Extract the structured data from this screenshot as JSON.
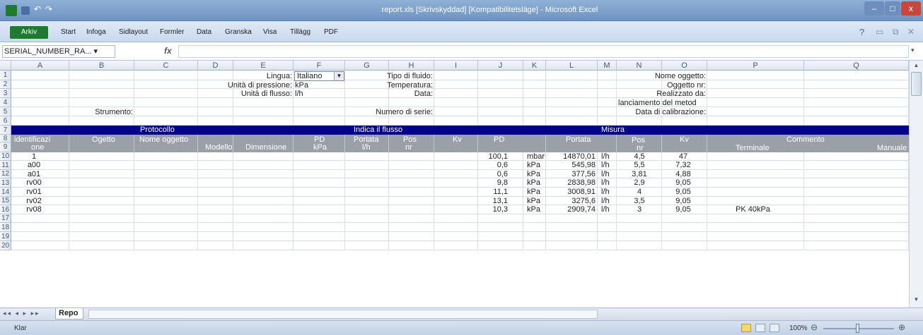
{
  "window": {
    "title": "report.xls [Skrivskyddad] [Kompatibilitetsläge] - Microsoft Excel",
    "minimize": "–",
    "maximize": "□",
    "close": "x"
  },
  "ribbon": {
    "file_tab": "Arkiv",
    "tabs": [
      "Start",
      "Infoga",
      "Sidlayout",
      "Formler",
      "Data",
      "Granska",
      "Visa",
      "Tillägg",
      "PDF"
    ]
  },
  "formula_bar": {
    "name_box": "SERIAL_NUMBER_RA... ▾",
    "fx": "fx",
    "value": ""
  },
  "columns": [
    "A",
    "B",
    "C",
    "D",
    "E",
    "F",
    "G",
    "H",
    "I",
    "J",
    "K",
    "L",
    "M",
    "N",
    "O",
    "P",
    "Q"
  ],
  "rows": [
    "1",
    "2",
    "3",
    "4",
    "5",
    "6",
    "7",
    "8",
    "9",
    "10",
    "11",
    "12",
    "13",
    "14",
    "15",
    "16",
    "17",
    "18",
    "19",
    "20"
  ],
  "header_area": {
    "lingua_label": "Lingua:",
    "lingua_value": "Italiano",
    "pressione_label": "Unità di pressione:",
    "pressione_value": "kPa",
    "flusso_label": "Unità di flusso:",
    "flusso_value": "l/h",
    "strumento_label": "Strumento:",
    "fluido_label": "Tipo di fluido:",
    "temperatura_label": "Temperatura:",
    "data_label": "Data:",
    "serie_label": "Numero di serie:",
    "nome_oggetto_label": "Nome oggetto:",
    "oggetto_nr_label": "Oggetto nr:",
    "realizzato_label": "Realizzato da:",
    "metodo_label": "lanciamento del metod",
    "calibrazione_label": "Data di calibrazione:"
  },
  "sections": {
    "protocollo": "Protocollo",
    "indica": "Indica il flusso",
    "misura": "Misura"
  },
  "table_headers": {
    "identificazione_1": "identificazi",
    "identificazione_2": "one",
    "oggetto": "Ogetto",
    "nome_oggetto": "Nome oggetto",
    "modello": "Modello",
    "dimensione": "Dimensione",
    "pd_1": "PD",
    "pd_2": "kPa",
    "portata_1": "Portata",
    "portata_2": "l/h",
    "pos_1": "Pos",
    "pos_2": "nr",
    "kv": "Kv",
    "m_pd": "PD",
    "m_portata": "Portata",
    "m_pos_1": "Pos",
    "m_pos_2": "nr",
    "m_kv": "Kv",
    "commento": "Commento",
    "terminale": "Terminale",
    "manuale": "Manuale"
  },
  "data_rows": [
    {
      "id": "1",
      "pd": "100,1",
      "pd_unit": "mbar",
      "portata": "14870,01",
      "portata_unit": "l/h",
      "pos": "4,5",
      "kv": "47",
      "terminale": ""
    },
    {
      "id": "a00",
      "pd": "0,6",
      "pd_unit": "kPa",
      "portata": "545,98",
      "portata_unit": "l/h",
      "pos": "5,5",
      "kv": "7,32",
      "terminale": ""
    },
    {
      "id": "a01",
      "pd": "0,6",
      "pd_unit": "kPa",
      "portata": "377,56",
      "portata_unit": "l/h",
      "pos": "3,81",
      "kv": "4,88",
      "terminale": ""
    },
    {
      "id": "rv00",
      "pd": "9,8",
      "pd_unit": "kPa",
      "portata": "2838,98",
      "portata_unit": "l/h",
      "pos": "2,9",
      "kv": "9,05",
      "terminale": ""
    },
    {
      "id": "rv01",
      "pd": "11,1",
      "pd_unit": "kPa",
      "portata": "3008,91",
      "portata_unit": "l/h",
      "pos": "4",
      "kv": "9,05",
      "terminale": ""
    },
    {
      "id": "rv02",
      "pd": "13,1",
      "pd_unit": "kPa",
      "portata": "3275,6",
      "portata_unit": "l/h",
      "pos": "3,5",
      "kv": "9,05",
      "terminale": ""
    },
    {
      "id": "rv08",
      "pd": "10,3",
      "pd_unit": "kPa",
      "portata": "2909,74",
      "portata_unit": "l/h",
      "pos": "3",
      "kv": "9,05",
      "terminale": "PK 40kPa"
    }
  ],
  "sheet_tab": "Repo",
  "status": {
    "ready": "Klar",
    "zoom": "100%"
  },
  "colors": {
    "section_band": "#00008b",
    "header_band": "#9aa0a8",
    "excel_green": "#1e7a2e"
  }
}
